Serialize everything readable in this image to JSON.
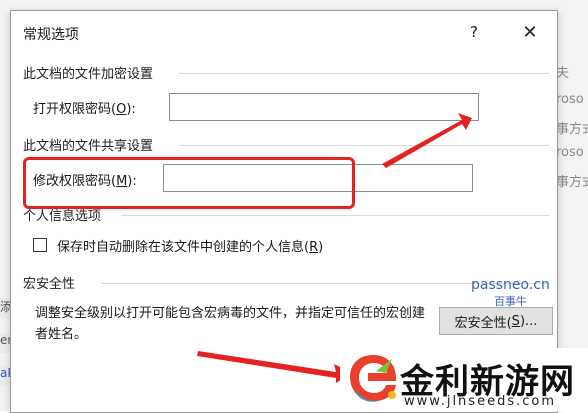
{
  "dialog": {
    "title": "常规选项",
    "help_label": "?",
    "close_label": "✕"
  },
  "background": {
    "right_texts": [
      "夫",
      "roso",
      "事方式",
      "roso",
      "事方式"
    ],
    "left_texts": [
      "添",
      "er",
      "aP"
    ]
  },
  "encryption": {
    "heading": "此文档的文件加密设置",
    "open_password_label": "打开权限密码(",
    "open_password_key": "O",
    "open_password_suffix": "):",
    "open_password_value": ""
  },
  "sharing": {
    "heading": "此文档的文件共享设置",
    "modify_password_label": "修改权限密码(",
    "modify_password_key": "M",
    "modify_password_suffix": "):",
    "modify_password_value": ""
  },
  "privacy": {
    "heading": "个人信息选项",
    "remove_info_label": "保存时自动删除在该文件中创建的个人信息(",
    "remove_info_key": "R",
    "remove_info_suffix": ")",
    "remove_info_checked": false
  },
  "macro": {
    "heading": "宏安全性",
    "description": "调整安全级别以打开可能包含宏病毒的文件，并指定可信任的宏创建者姓名。",
    "button_label": "宏安全性(",
    "button_key": "S",
    "button_suffix": ")..."
  },
  "watermark": {
    "line1": "passneo.cn",
    "line2": "百事牛"
  },
  "logo": {
    "brand": "金利新游网",
    "url": "www.jlnseeds.com"
  },
  "colors": {
    "annotation_red": "#e52222",
    "watermark_blue": "#3a64b8"
  }
}
